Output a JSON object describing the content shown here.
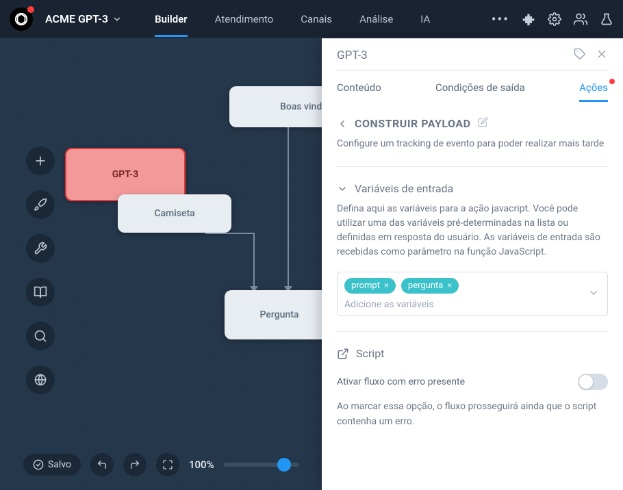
{
  "header": {
    "app_name": "ACME GPT-3",
    "nav": {
      "builder": "Builder",
      "atendimento": "Atendimento",
      "canais": "Canais",
      "analise": "Análise",
      "ia": "IA"
    }
  },
  "canvas": {
    "nodes": {
      "welcome": "Boas vindas",
      "gpt": "GPT-3",
      "camiseta": "Camiseta",
      "pergunta": "Pergunta"
    }
  },
  "bottom": {
    "saved": "Salvo",
    "zoom": "100%"
  },
  "panel": {
    "title": "GPT-3",
    "tabs": {
      "conteudo": "Conteúdo",
      "condicoes": "Condições de saída",
      "acoes": "Ações"
    },
    "payload": {
      "title": "CONSTRUIR PAYLOAD",
      "desc": "Configure um tracking de evento para poder realizar mais tarde"
    },
    "vars": {
      "title": "Variáveis de entrada",
      "desc": "Defina aqui as variáveis para a ação javacript. Você pode utilizar uma das variáveis pré-determinadas na lista ou definidas em resposta do usuário. As variáveis de entrada são recebidas como parâmetro na função JavaScript.",
      "tags": [
        "prompt",
        "pergunta"
      ],
      "placeholder": "Adicione as variáveis"
    },
    "script": {
      "title": "Script",
      "toggle_label": "Ativar fluxo com erro presente",
      "toggle_desc": "Ao marcar essa opção, o fluxo prosseguirá ainda que o script contenha um erro."
    }
  }
}
